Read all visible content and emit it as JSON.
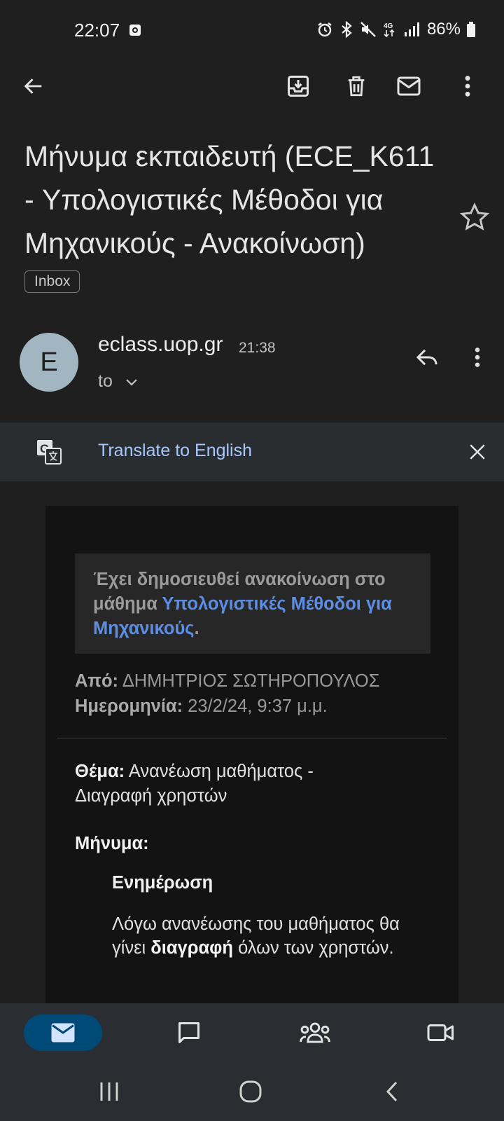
{
  "status_bar": {
    "time": "22:07",
    "network": "4G",
    "battery": "86%"
  },
  "toolbar": {
    "icons": [
      "back-arrow-icon",
      "archive-icon",
      "delete-icon",
      "mark-unread-icon",
      "more-vert-icon"
    ]
  },
  "email": {
    "subject": "Μήνυμα εκπαιδευτή (ECE_K611 - Υπολογιστικές Μέθοδοι για Μηχανικούς - Ανακοίνωση)",
    "label": "Inbox",
    "starred": false
  },
  "sender": {
    "initial": "E",
    "name": "eclass.uop.gr",
    "time": "21:38",
    "to_label": "to"
  },
  "translate": {
    "label": "Translate to English"
  },
  "body": {
    "notice_prefix": "Έχει δημοσιευθεί ανακοίνωση στο μάθημα ",
    "notice_link": "Υπολογιστικές Μέθοδοι για Μηχανικούς",
    "notice_suffix": ".",
    "from_label": "Από:",
    "from_value": " ΔΗΜΗΤΡΙΟΣ ΣΩΤΗΡΟΠΟΥΛΟΣ",
    "date_label": "Ημερομηνία:",
    "date_value": " 23/2/24, 9:37 μ.μ.",
    "subject_label": "Θέμα:",
    "subject_value": " Ανανέωση μαθήματος - Διαγραφή χρηστών",
    "message_label": "Μήνυμα:",
    "update_title": "Ενημέρωση",
    "update_text_1": "Λόγω ανανέωσης του μαθήματος θα γίνει ",
    "update_text_bold": "διαγραφή",
    "update_text_2": " όλων των χρηστών."
  },
  "bottom_nav": {
    "items": [
      "mail",
      "chat",
      "spaces",
      "meet"
    ],
    "active": "mail"
  },
  "colors": {
    "background": "#1f1f1f",
    "link": "#5c8ee6",
    "translate_link": "#a8c7fa",
    "active_nav": "#004a77",
    "avatar": "#a1b6c0"
  }
}
